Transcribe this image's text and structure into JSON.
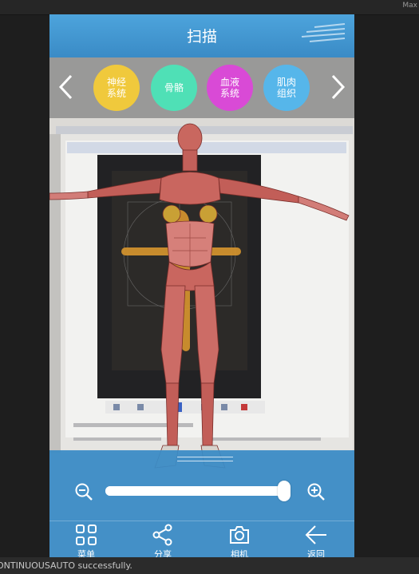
{
  "editor": {
    "maximize_label": "Max",
    "status_message": "ONTINUOUSAUTO successfully."
  },
  "header": {
    "title": "扫描"
  },
  "systems": {
    "items": [
      {
        "label": "神经系统",
        "color": "#f0c93c"
      },
      {
        "label": "骨骼",
        "color": "#4fe0b6"
      },
      {
        "label": "血液系统",
        "color": "#d94ad6"
      },
      {
        "label": "肌肉组织",
        "color": "#56b6ea"
      }
    ]
  },
  "zoom": {
    "level": 1.0
  },
  "tabs": [
    {
      "label": "菜单",
      "icon": "grid-menu-icon"
    },
    {
      "label": "分享",
      "icon": "share-icon"
    },
    {
      "label": "相机",
      "icon": "camera-icon"
    },
    {
      "label": "返回",
      "icon": "back-arrow-icon"
    }
  ],
  "colors": {
    "primary": "#3a8bc6",
    "header_top": "#4da4dc"
  }
}
